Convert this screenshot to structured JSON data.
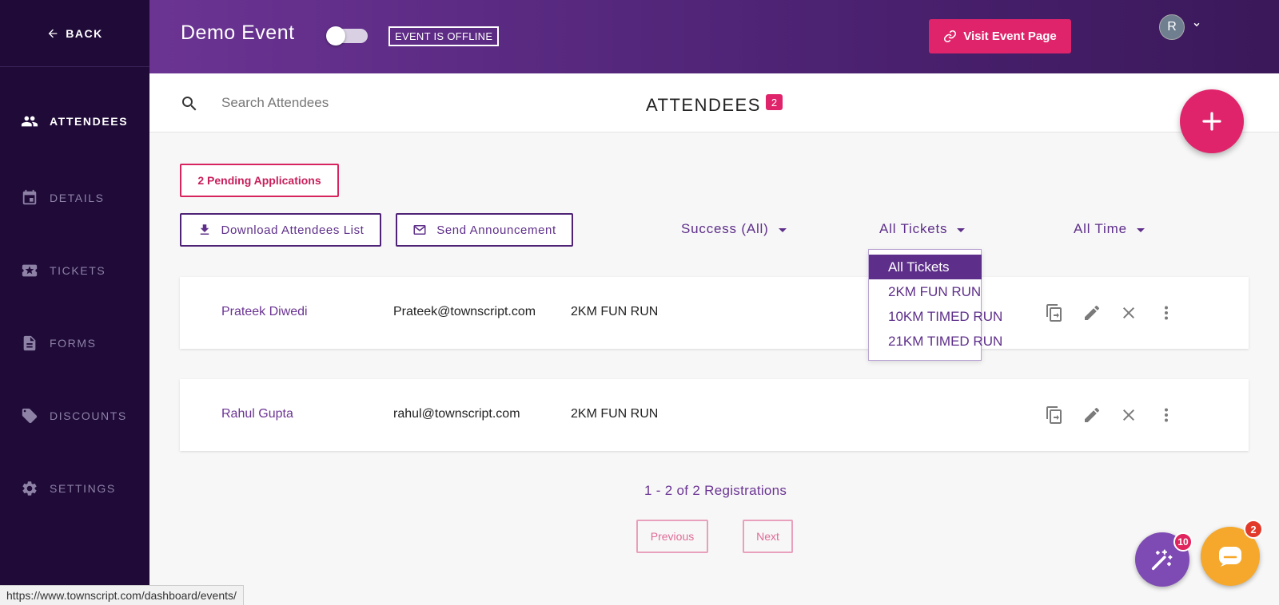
{
  "sidebar": {
    "back_label": "BACK",
    "items": [
      {
        "label": "ATTENDEES",
        "icon": "people-icon",
        "active": true
      },
      {
        "label": "DETAILS",
        "icon": "calendar-icon",
        "active": false
      },
      {
        "label": "TICKETS",
        "icon": "ticket-icon",
        "active": false
      },
      {
        "label": "FORMS",
        "icon": "document-icon",
        "active": false
      },
      {
        "label": "DISCOUNTS",
        "icon": "tag-icon",
        "active": false
      },
      {
        "label": "SETTINGS",
        "icon": "gear-icon",
        "active": false
      }
    ]
  },
  "header": {
    "event_title": "Demo Event",
    "offline_badge": "EVENT IS OFFLINE",
    "visit_button": "Visit Event Page",
    "avatar_initial": "R"
  },
  "search": {
    "placeholder": "Search Attendees",
    "value": ""
  },
  "attendees_heading": {
    "title": "ATTENDEES",
    "count": "2"
  },
  "actions": {
    "pending_applications": "2 Pending Applications",
    "download_list": "Download Attendees List",
    "send_announcement": "Send Announcement"
  },
  "filters": {
    "status": "Success (All)",
    "tickets": "All Tickets",
    "time": "All Time"
  },
  "ticket_dropdown": {
    "options": [
      "All Tickets",
      "2KM FUN RUN",
      "10KM TIMED RUN",
      "21KM TIMED RUN"
    ],
    "selected": "All Tickets"
  },
  "attendees": [
    {
      "name": "Prateek Diwedi",
      "email": "Prateek@townscript.com",
      "ticket": "2KM FUN RUN"
    },
    {
      "name": "Rahul Gupta",
      "email": "rahul@townscript.com",
      "ticket": "2KM FUN RUN"
    }
  ],
  "pagination": {
    "summary": "1 - 2 of 2 Registrations",
    "previous": "Previous",
    "next": "Next"
  },
  "widgets": {
    "wand_badge": "10",
    "chat_badge": "2"
  },
  "status_url": "https://www.townscript.com/dashboard/events/",
  "colors": {
    "sidebar_bg": "#1f0a38",
    "header_purple": "#5e2f8a",
    "accent_pink": "#e0246b",
    "chat_orange": "#f5a82b"
  }
}
